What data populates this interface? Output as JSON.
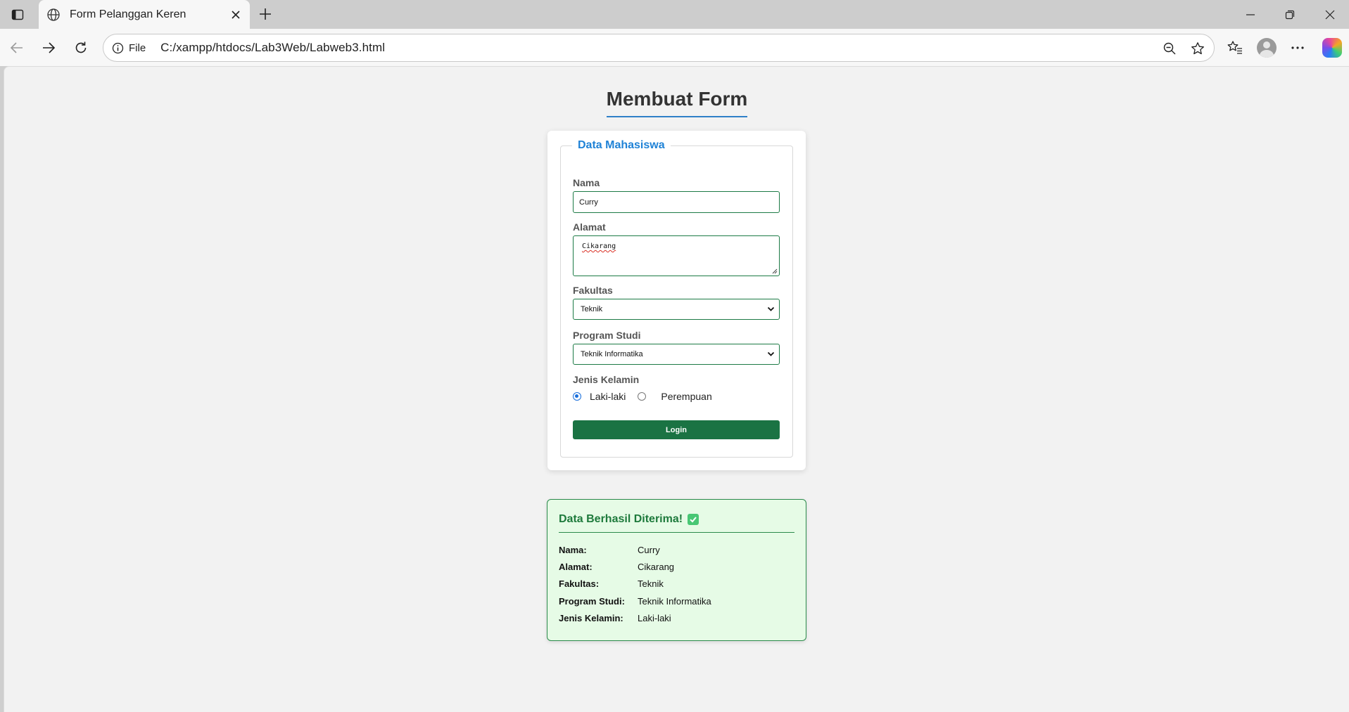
{
  "browser": {
    "tab_title": "Form Pelanggan Keren",
    "site_chip": "File",
    "url": "C:/xampp/htdocs/Lab3Web/Labweb3.html"
  },
  "page": {
    "title": "Membuat Form"
  },
  "form": {
    "legend": "Data Mahasiswa",
    "nama_label": "Nama",
    "nama_value": "Curry",
    "alamat_label": "Alamat",
    "alamat_value": "Cikarang",
    "fakultas_label": "Fakultas",
    "fakultas_value": "Teknik",
    "prodi_label": "Program Studi",
    "prodi_value": "Teknik Informatika",
    "gender_label": "Jenis Kelamin",
    "gender_options": [
      "Laki-laki",
      "Perempuan"
    ],
    "gender_selected": "Laki-laki",
    "login_label": "Login"
  },
  "result": {
    "title": "Data Berhasil Diterima!",
    "rows": [
      {
        "key": "Nama:",
        "value": "Curry"
      },
      {
        "key": "Alamat:",
        "value": "Cikarang"
      },
      {
        "key": "Fakultas:",
        "value": "Teknik"
      },
      {
        "key": "Program Studi:",
        "value": "Teknik Informatika"
      },
      {
        "key": "Jenis Kelamin:",
        "value": "Laki-laki"
      }
    ]
  },
  "colors": {
    "accent_blue": "#1f82d6",
    "form_green": "#1a7343",
    "success_bg": "#e6fbe6",
    "success_text": "#1e7a3c"
  },
  "icons": {
    "tab_actions": "tab-actions-icon",
    "favicon": "globe-icon",
    "close": "close-icon",
    "new_tab": "plus-icon",
    "back": "back-arrow-icon",
    "forward": "forward-arrow-icon",
    "reload": "reload-icon",
    "info": "info-icon",
    "zoom": "zoom-out-icon",
    "favorite": "star-icon",
    "favorites": "favorites-icon",
    "profile": "profile-icon",
    "more": "more-icon",
    "copilot": "copilot-icon",
    "check": "check-mark-icon"
  }
}
